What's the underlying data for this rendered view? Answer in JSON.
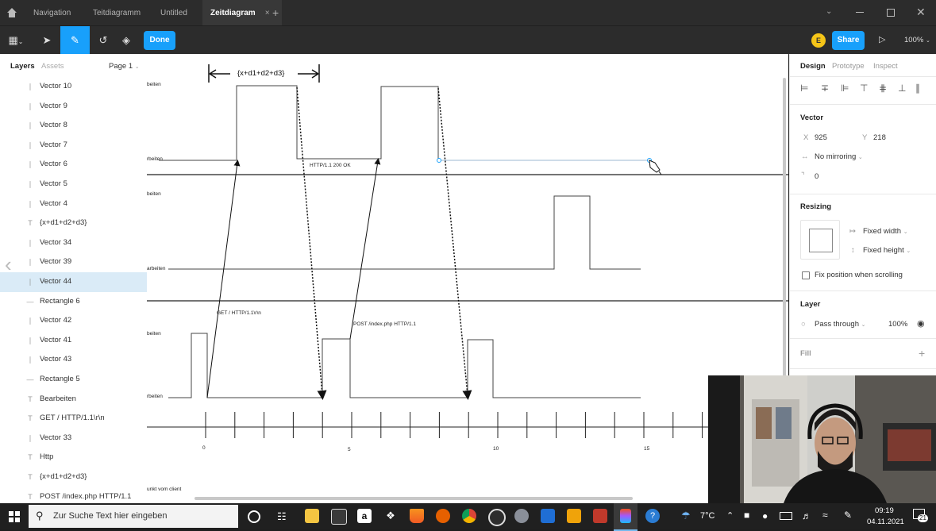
{
  "tabs": [
    "Navigation",
    "Teitdiagramm",
    "Untitled",
    "Zeitdiagram"
  ],
  "active_tab_close": "×",
  "add_tab": "+",
  "toolbar": {
    "done_label": "Done",
    "share_label": "Share",
    "zoom": "100%",
    "avatar_initial": "E"
  },
  "left_panel": {
    "tab_layers": "Layers",
    "tab_assets": "Assets",
    "page": "Page 1",
    "layers": [
      {
        "icon": "vector-icon",
        "label": "Vector 10"
      },
      {
        "icon": "vector-icon",
        "label": "Vector 9"
      },
      {
        "icon": "vector-icon",
        "label": "Vector 8"
      },
      {
        "icon": "vector-icon",
        "label": "Vector 7"
      },
      {
        "icon": "vector-icon",
        "label": "Vector 6"
      },
      {
        "icon": "vector-icon",
        "label": "Vector 5"
      },
      {
        "icon": "vector-icon",
        "label": "Vector 4"
      },
      {
        "icon": "text-icon",
        "label": "{x+d1+d2+d3}"
      },
      {
        "icon": "vector-icon",
        "label": "Vector 34"
      },
      {
        "icon": "vector-icon",
        "label": "Vector 39"
      },
      {
        "icon": "vector-icon",
        "label": "Vector 44"
      },
      {
        "icon": "line-icon",
        "label": "Rectangle 6"
      },
      {
        "icon": "vector-icon",
        "label": "Vector 42"
      },
      {
        "icon": "vector-icon",
        "label": "Vector 41"
      },
      {
        "icon": "vector-icon",
        "label": "Vector 43"
      },
      {
        "icon": "line-icon",
        "label": "Rectangle 5"
      },
      {
        "icon": "text-icon",
        "label": "Bearbeiten"
      },
      {
        "icon": "text-icon",
        "label": "GET / HTTP/1.1\\r\\n"
      },
      {
        "icon": "vector-icon",
        "label": "Vector 33"
      },
      {
        "icon": "text-icon",
        "label": "Http"
      },
      {
        "icon": "text-icon",
        "label": "{x+d1+d2+d3}"
      },
      {
        "icon": "text-icon",
        "label": "POST /index.php HTTP/1.1"
      }
    ],
    "selected_layer": "Vector 44"
  },
  "canvas": {
    "interval_label": "{x+d1+d2+d3}",
    "ok_label": "HTTP/1.1 200 OK",
    "get_label": "GET / HTTP/1.1\\r\\n",
    "post_label": "POST /index.php HTTP/1.1",
    "row_labels": [
      "beiten",
      "rbeiten",
      "beiten",
      "arbeiten",
      "beiten",
      "rbeiten",
      "unkt vom client"
    ],
    "ticks": [
      "0",
      "5",
      "10",
      "15"
    ]
  },
  "right_panel": {
    "tabs": [
      "Design",
      "Prototype",
      "Inspect"
    ],
    "vector_heading": "Vector",
    "x_label": "X",
    "x_value": "925",
    "y_label": "Y",
    "y_value": "218",
    "mirroring": "No mirroring",
    "corner_value": "0",
    "resizing_heading": "Resizing",
    "fixed_width": "Fixed width",
    "fixed_height": "Fixed height",
    "fix_position": "Fix position when scrolling",
    "layer_heading": "Layer",
    "blend": "Pass through",
    "opacity": "100%",
    "fill_heading": "Fill",
    "fill_add": "+"
  },
  "taskbar": {
    "search_placeholder": "Zur Suche Text hier eingeben",
    "temperature": "7°C",
    "time": "09:19",
    "date": "04.11.2021",
    "notifications": "21"
  },
  "colors": {
    "accent": "#18a0fb",
    "selection": "#daebf7",
    "ui_dark": "#2c2c2c"
  }
}
